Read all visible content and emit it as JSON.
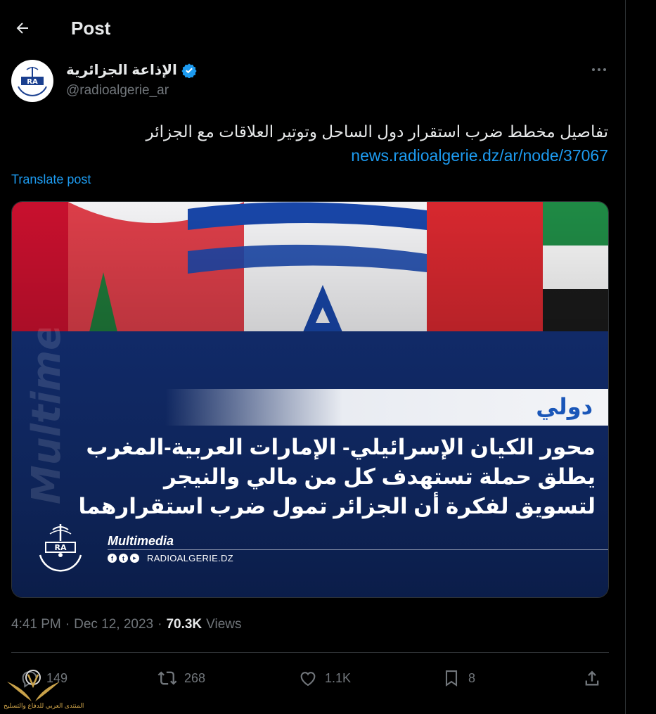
{
  "header": {
    "title": "Post"
  },
  "author": {
    "display_name": "الإذاعة الجزائرية",
    "handle": "@radioalgerie_ar",
    "verified": true,
    "logo_text": "RA"
  },
  "post": {
    "text": "تفاصيل مخطط ضرب استقرار دول الساحل وتوتير العلاقات مع الجزائر",
    "link": "news.radioalgerie.dz/ar/node/37067",
    "translate_label": "Translate post"
  },
  "media": {
    "category": "دولي",
    "headline_lines": [
      "محور الكيان الإسرائيلي- الإمارات العربية-المغرب",
      "يطلق حملة تستهدف كل من مالي والنيجر",
      "لتسويق لفكرة أن الجزائر تمول ضرب استقرارهما"
    ],
    "watermark": "Multimedia",
    "brand_name": "Multimedia",
    "brand_url": "RADIOALGERIE.DZ",
    "social_icons": [
      "facebook-icon",
      "twitter-icon",
      "youtube-icon"
    ]
  },
  "meta": {
    "time": "4:41 PM",
    "separator": "·",
    "date": "Dec 12, 2023",
    "views_count": "70.3K",
    "views_label": "Views"
  },
  "actions": {
    "replies": "149",
    "reposts": "268",
    "likes": "1.1K",
    "bookmarks": "8"
  },
  "overlay": {
    "forum_text": "المنتدى العربي للدفاع والتسليح"
  },
  "colors": {
    "background": "#000000",
    "text_primary": "#e7e9ea",
    "text_secondary": "#71767b",
    "accent": "#1d9bf0",
    "media_blue": "#0e2458"
  }
}
